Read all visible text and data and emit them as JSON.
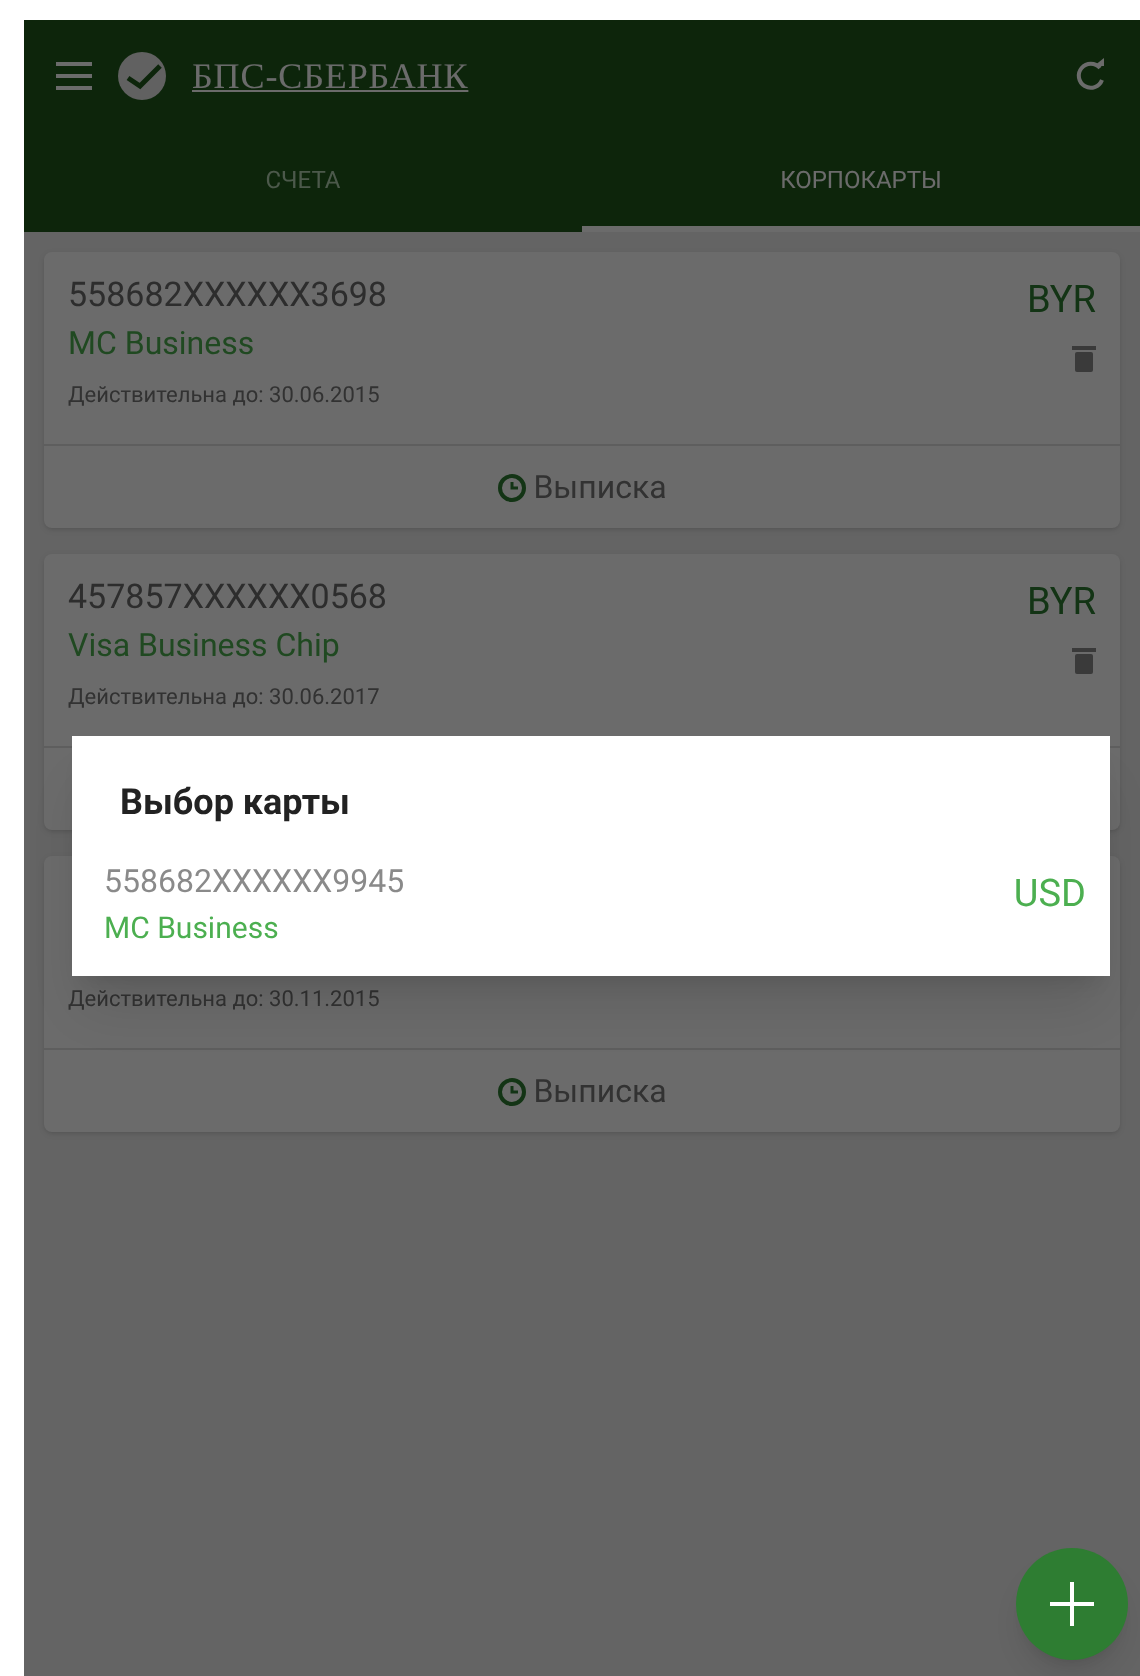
{
  "app_bar": {
    "logo_text": "БПС-СБЕРБАНК"
  },
  "tabs": [
    {
      "label": "СЧЕТА",
      "selected": false
    },
    {
      "label": "КОРПОКАРТЫ",
      "selected": true
    }
  ],
  "cards": [
    {
      "number": "558682XXXXXX3698",
      "name": "MC Business",
      "validity": "Действительна до: 30.06.2015",
      "currency": "BYR",
      "statement_button": "Выписка"
    },
    {
      "number": "457857XXXXXX0568",
      "name": "Visa Business Chip",
      "validity": "Действительна до: 30.06.2017",
      "currency": "BYR"
    },
    {
      "validity": "Действительна до: 30.11.2015",
      "statement_button": "Выписка"
    }
  ],
  "dialog": {
    "title": "Выбор карты",
    "items": [
      {
        "number": "558682XXXXXX9945",
        "name": "MC Business",
        "currency": "USD"
      }
    ]
  }
}
